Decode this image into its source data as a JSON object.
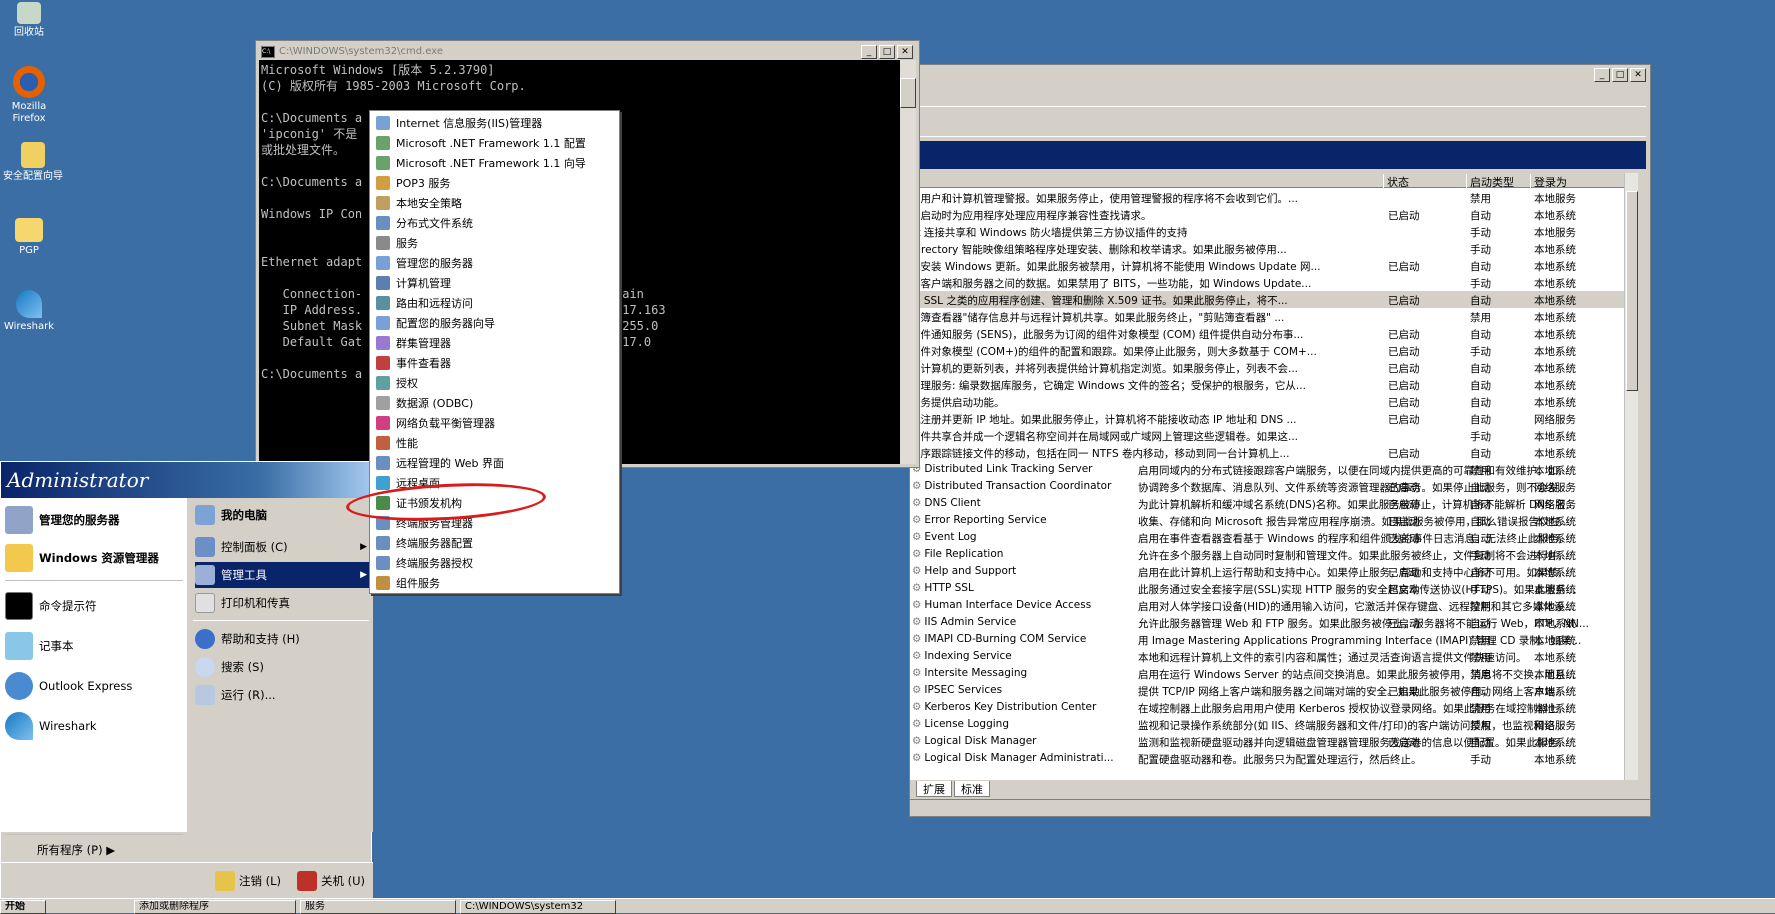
{
  "desktop": {
    "icons": [
      {
        "label": "回收站",
        "icon": "recycle-bin-icon"
      },
      {
        "label": "Mozilla Firefox",
        "icon": "firefox-icon"
      },
      {
        "label": "安全配置向导",
        "icon": "security-wizard-icon"
      },
      {
        "label": "PGP",
        "icon": "folder-icon"
      },
      {
        "label": "Wireshark",
        "icon": "wireshark-icon"
      }
    ]
  },
  "cmd": {
    "title": "C:\\WINDOWS\\system32\\cmd.exe",
    "lines": [
      "Microsoft Windows [版本 5.2.3790]",
      "(C) 版权所有 1985-2003 Microsoft Corp.",
      "",
      "C:\\Documents a                                 ig",
      "'ipconig' 不是                                  序",
      "或批处理文件。",
      "",
      "C:\\Documents a                                 fig",
      "",
      "Windows IP Con",
      "",
      "",
      "Ethernet adapt",
      "",
      "   Connection-                                  omain",
      "   IP Address.                                  8.17.163",
      "   Subnet Mask                                  5.255.0",
      "   Default Gat                                  8.17.0",
      "",
      "C:\\Documents a"
    ]
  },
  "services": {
    "columns": {
      "status": "状态",
      "startup": "启动类型",
      "logon": "登录为"
    },
    "partial_rows": [
      {
        "desc": "的用户和计算机管理警报。如果服务停止，使用管理警报的程序将不会收到它们。...",
        "status": "",
        "startup": "禁用",
        "logon": "本地服务"
      },
      {
        "desc": "序启动时为应用程序处理应用程序兼容性查找请求。",
        "status": "已启动",
        "startup": "自动",
        "logon": "本地系统"
      },
      {
        "desc": "et 连接共享和 Windows 防火墙提供第三方协议插件的支持",
        "status": "",
        "startup": "手动",
        "logon": "本地服务"
      },
      {
        "desc": " Directory 智能映像组策略程序处理安装、删除和枚举请求。如果此服务被停用...",
        "status": "",
        "startup": "手动",
        "logon": "本地系统"
      },
      {
        "desc": "并安装 Windows 更新。如果此服务被禁用，计算机将不能使用 Windows Update 网...",
        "status": "已启动",
        "startup": "自动",
        "logon": "本地系统"
      },
      {
        "desc": "端客户端和服务器之间的数据。如果禁用了 BITS，一些功能，如 Windows Update...",
        "status": "",
        "startup": "手动",
        "logon": "本地系统"
      },
      {
        "desc": " 和 SSL 之类的应用程序创建、管理和删除 X.509 证书。如果此服务停止，将不...",
        "status": "已启动",
        "startup": "自动",
        "logon": "本地系统"
      },
      {
        "desc": "贴簿查看器\"储存信息并与远程计算机共享。如果此服务终止，\"剪贴簿查看器\" ...",
        "status": "",
        "startup": "禁用",
        "logon": "本地系统"
      },
      {
        "desc": "事件通知服务 (SENS)，此服务为订阅的组件对象模型 (COM) 组件提供自动分布事...",
        "status": "已启动",
        "startup": "自动",
        "logon": "本地系统"
      },
      {
        "desc": "组件对象模型 (COM+)的组件的配置和跟踪。如果停止此服务，则大多数基于 COM+...",
        "status": "已启动",
        "startup": "手动",
        "logon": "本地系统"
      },
      {
        "desc": "上计算机的更新列表，并将列表提供给计算机指定浏览。如果服务停止，列表不会...",
        "status": "已启动",
        "startup": "自动",
        "logon": "本地系统"
      },
      {
        "desc": "管理服务: 编录数据库服务，它确定 Windows 文件的签名；受保护的根服务，它从...",
        "status": "已启动",
        "startup": "自动",
        "logon": "本地系统"
      },
      {
        "desc": "服务提供启动功能。",
        "status": "已启动",
        "startup": "自动",
        "logon": "本地系统"
      },
      {
        "desc": "机注册并更新 IP 地址。如果此服务停止，计算机将不能接收动态 IP 地址和 DNS ...",
        "status": "已启动",
        "startup": "自动",
        "logon": "网络服务"
      },
      {
        "desc": "文件共享合并成一个逻辑名称空间并在局域网或广域网上管理这些逻辑卷。如果这...",
        "status": "",
        "startup": "手动",
        "logon": "本地系统"
      },
      {
        "desc": "程序跟踪链接文件的移动，包括在同一 NTFS 卷内移动，移动到同一台计算机上...",
        "status": "已启动",
        "startup": "自动",
        "logon": "本地系统"
      }
    ],
    "full_rows": [
      {
        "name": "Distributed Link Tracking Server",
        "desc": "启用同域内的分布式链接跟踪客户端服务，以便在同域内提供更高的可靠性和有效维护。如...",
        "status": "",
        "startup": "禁用",
        "logon": "本地系统"
      },
      {
        "name": "Distributed Transaction Coordinator",
        "desc": "协调跨多个数据库、消息队列、文件系统等资源管理器的事务。如果停止此服务，则不会发...",
        "status": "已启动",
        "startup": "自动",
        "logon": "网络服务"
      },
      {
        "name": "DNS Client",
        "desc": "为此计算机解析和缓冲域名系统(DNS)名称。如果此服务被停止，计算机将不能解析 DNS 名...",
        "status": "已启动",
        "startup": "自动",
        "logon": "网络服务"
      },
      {
        "name": "Error Reporting Service",
        "desc": "收集、存储和向 Microsoft 报告异常应用程序崩溃。如果此服务被停用，那么错误报告仅在...",
        "status": "已启动",
        "startup": "自动",
        "logon": "本地系统"
      },
      {
        "name": "Event Log",
        "desc": "启用在事件查看器查看基于 Windows 的程序和组件颁发的事件日志消息。无法终止此服务。",
        "status": "已启动",
        "startup": "自动",
        "logon": "本地系统"
      },
      {
        "name": "File Replication",
        "desc": "允许在多个服务器上自动同时复制和管理文件。如果此服务被终止，文件复制将不会进行并...",
        "status": "",
        "startup": "手动",
        "logon": "本地系统"
      },
      {
        "name": "Help and Support",
        "desc": "启用在此计算机上运行帮助和支持中心。如果停止服务，帮助和支持中心将不可用。如果禁...",
        "status": "已启动",
        "startup": "自动",
        "logon": "本地系统"
      },
      {
        "name": "HTTP SSL",
        "desc": "此服务通过安全套接字层(SSL)实现 HTTP 服务的安全超文本传送协议(HTTPS)。如果此服务...",
        "status": "已启动",
        "startup": "手动",
        "logon": "本地系统"
      },
      {
        "name": "Human Interface Device Access",
        "desc": "启用对人体学接口设备(HID)的通用输入访问，它激活并保存键盘、远程控制和其它多媒体设...",
        "status": "",
        "startup": "禁用",
        "logon": "本地系统"
      },
      {
        "name": "IIS Admin Service",
        "desc": "允许此服务器管理 Web 和 FTP 服务。如果此服务被停止，服务器将不能运行 Web，FTP，NN...",
        "status": "已启动",
        "startup": "自动",
        "logon": "本地系统"
      },
      {
        "name": "IMAPI CD-Burning COM Service",
        "desc": "用 Image Mastering Applications Programming Interface (IMAPI) 管理 CD 录制。如果...",
        "status": "",
        "startup": "禁用",
        "logon": "本地系统"
      },
      {
        "name": "Indexing Service",
        "desc": "本地和远程计算机上文件的索引内容和属性；通过灵活查询语言提供文件快速访问。",
        "status": "",
        "startup": "禁用",
        "logon": "本地系统"
      },
      {
        "name": "Intersite Messaging",
        "desc": "启用在运行 Windows Server 的站点间交换消息。如果此服务被停用，消息将不交换，而且...",
        "status": "",
        "startup": "禁用",
        "logon": "本地系统"
      },
      {
        "name": "IPSEC Services",
        "desc": "提供 TCP/IP 网络上客户端和服务器之间端对端的安全。如果此服务被停用，网络上客户端...",
        "status": "已启动",
        "startup": "自动",
        "logon": "本地系统"
      },
      {
        "name": "Kerberos Key Distribution Center",
        "desc": "在域控制器上此服务启用用户使用 Kerberos 授权协议登录网络。如果此服务在域控制器上...",
        "status": "",
        "startup": "禁用",
        "logon": "本地系统"
      },
      {
        "name": "License Logging",
        "desc": "监视和记录操作系统部分(如 IIS、终端服务器和文件/打印)的客户端访问授权，也监视和记...",
        "status": "",
        "startup": "禁用",
        "logon": "网络服务"
      },
      {
        "name": "Logical Disk Manager",
        "desc": "监测和监视新硬盘驱动器并向逻辑磁盘管理器管理服务发送卷的信息以便配置。如果此服务...",
        "status": "已启动",
        "startup": "自动",
        "logon": "本地系统"
      },
      {
        "name": "Logical Disk Manager Administrati...",
        "desc": "配置硬盘驱动器和卷。此服务只为配置处理运行，然后终止。",
        "status": "",
        "startup": "手动",
        "logon": "本地系统"
      }
    ],
    "tabs": [
      "扩展",
      "标准"
    ]
  },
  "start_menu": {
    "user": "Administrator",
    "pinned": [
      {
        "label": "管理您的服务器",
        "icon": "server-manage-icon"
      },
      {
        "label": "Windows 资源管理器",
        "icon": "explorer-icon"
      }
    ],
    "recent": [
      {
        "label": "命令提示符",
        "icon": "cmd-icon"
      },
      {
        "label": "记事本",
        "icon": "notepad-icon"
      },
      {
        "label": "Outlook Express",
        "icon": "outlook-icon"
      },
      {
        "label": "Wireshark",
        "icon": "wireshark-icon"
      }
    ],
    "right_items": [
      {
        "label": "我的电脑",
        "icon": "my-computer-icon"
      },
      {
        "label": "控制面板 (C)",
        "icon": "control-panel-icon"
      },
      {
        "label": "管理工具",
        "icon": "admin-tools-icon"
      },
      {
        "label": "打印机和传真",
        "icon": "printer-icon"
      },
      {
        "label": "帮助和支持 (H)",
        "icon": "help-icon"
      },
      {
        "label": "搜索 (S)",
        "icon": "search-icon"
      },
      {
        "label": "运行 (R)...",
        "icon": "run-icon"
      }
    ],
    "all_programs": "所有程序 (P)",
    "logoff": "注销 (L)",
    "shutdown": "关机 (U)"
  },
  "admin_tools": [
    "Internet 信息服务(IIS)管理器",
    "Microsoft .NET Framework 1.1 配置",
    "Microsoft .NET Framework 1.1 向导",
    "POP3 服务",
    "本地安全策略",
    "分布式文件系统",
    "服务",
    "管理您的服务器",
    "计算机管理",
    "路由和远程访问",
    "配置您的服务器向导",
    "群集管理器",
    "事件查看器",
    "授权",
    "数据源 (ODBC)",
    "网络负载平衡管理器",
    "性能",
    "远程管理的 Web 界面",
    "远程桌面",
    "证书颁发机构",
    "终端服务管理器",
    "终端服务器配置",
    "终端服务器授权",
    "组件服务"
  ],
  "taskbar": {
    "start": "开始",
    "items": [
      "添加或删除程序",
      "服务",
      "C:\\WINDOWS\\system32"
    ]
  },
  "colors": {
    "desktop": "#3a6ea5",
    "title_active": "#0a246a",
    "annotation": "#d81b1b"
  }
}
